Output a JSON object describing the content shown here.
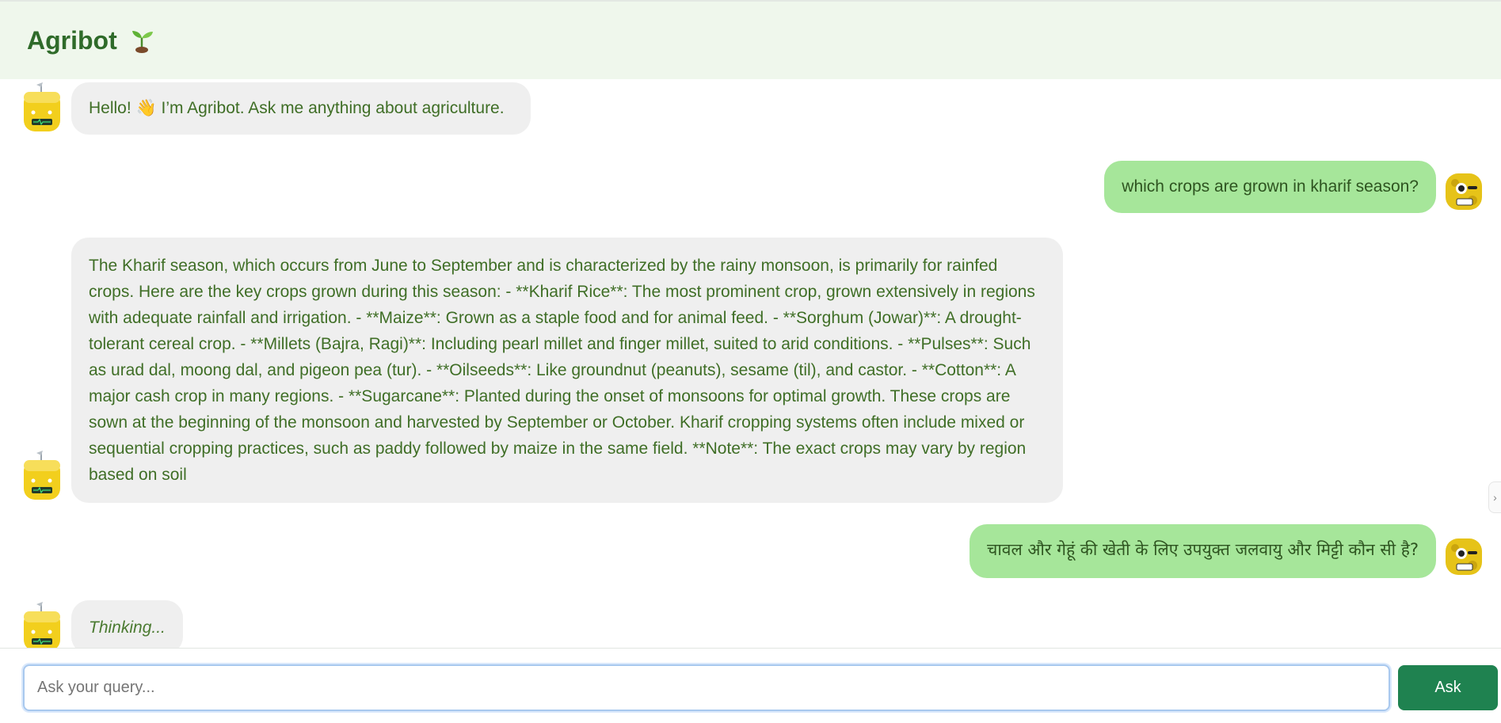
{
  "header": {
    "title": "Agribot"
  },
  "messages": [
    {
      "role": "bot",
      "text": "Hello! 👋 I’m Agribot. Ask me anything about agriculture."
    },
    {
      "role": "user",
      "text": "which crops are grown in kharif season?"
    },
    {
      "role": "bot",
      "text": "The Kharif season, which occurs from June to September and is characterized by the rainy monsoon, is primarily for rainfed crops. Here are the key crops grown during this season: - **Kharif Rice**: The most prominent crop, grown extensively in regions with adequate rainfall and irrigation. - **Maize**: Grown as a staple food and for animal feed. - **Sorghum (Jowar)**: A drought-tolerant cereal crop. - **Millets (Bajra, Ragi)**: Including pearl millet and finger millet, suited to arid conditions. - **Pulses**: Such as urad dal, moong dal, and pigeon pea (tur). - **Oilseeds**: Like groundnut (peanuts), sesame (til), and castor. - **Cotton**: A major cash crop in many regions. - **Sugarcane**: Planted during the onset of monsoons for optimal growth. These crops are sown at the beginning of the monsoon and harvested by September or October. Kharif cropping systems often include mixed or sequential cropping practices, such as paddy followed by maize in the same field. **Note**: The exact crops may vary by region based on soil"
    },
    {
      "role": "user",
      "text": "चावल और गेहूं की खेती के लिए उपयुक्त जलवायु और मिट्टी कौन सी है?"
    },
    {
      "role": "bot",
      "text": "Thinking..."
    }
  ],
  "input": {
    "placeholder": "Ask your query...",
    "value": ""
  },
  "ask_button": {
    "label": "Ask"
  },
  "edge_tab": {
    "label": "›"
  },
  "colors": {
    "header_bg": "#eff7ec",
    "title": "#2f6b2a",
    "bot_bubble": "#efefef",
    "user_bubble": "#a6e69a",
    "button": "#1f8250"
  }
}
